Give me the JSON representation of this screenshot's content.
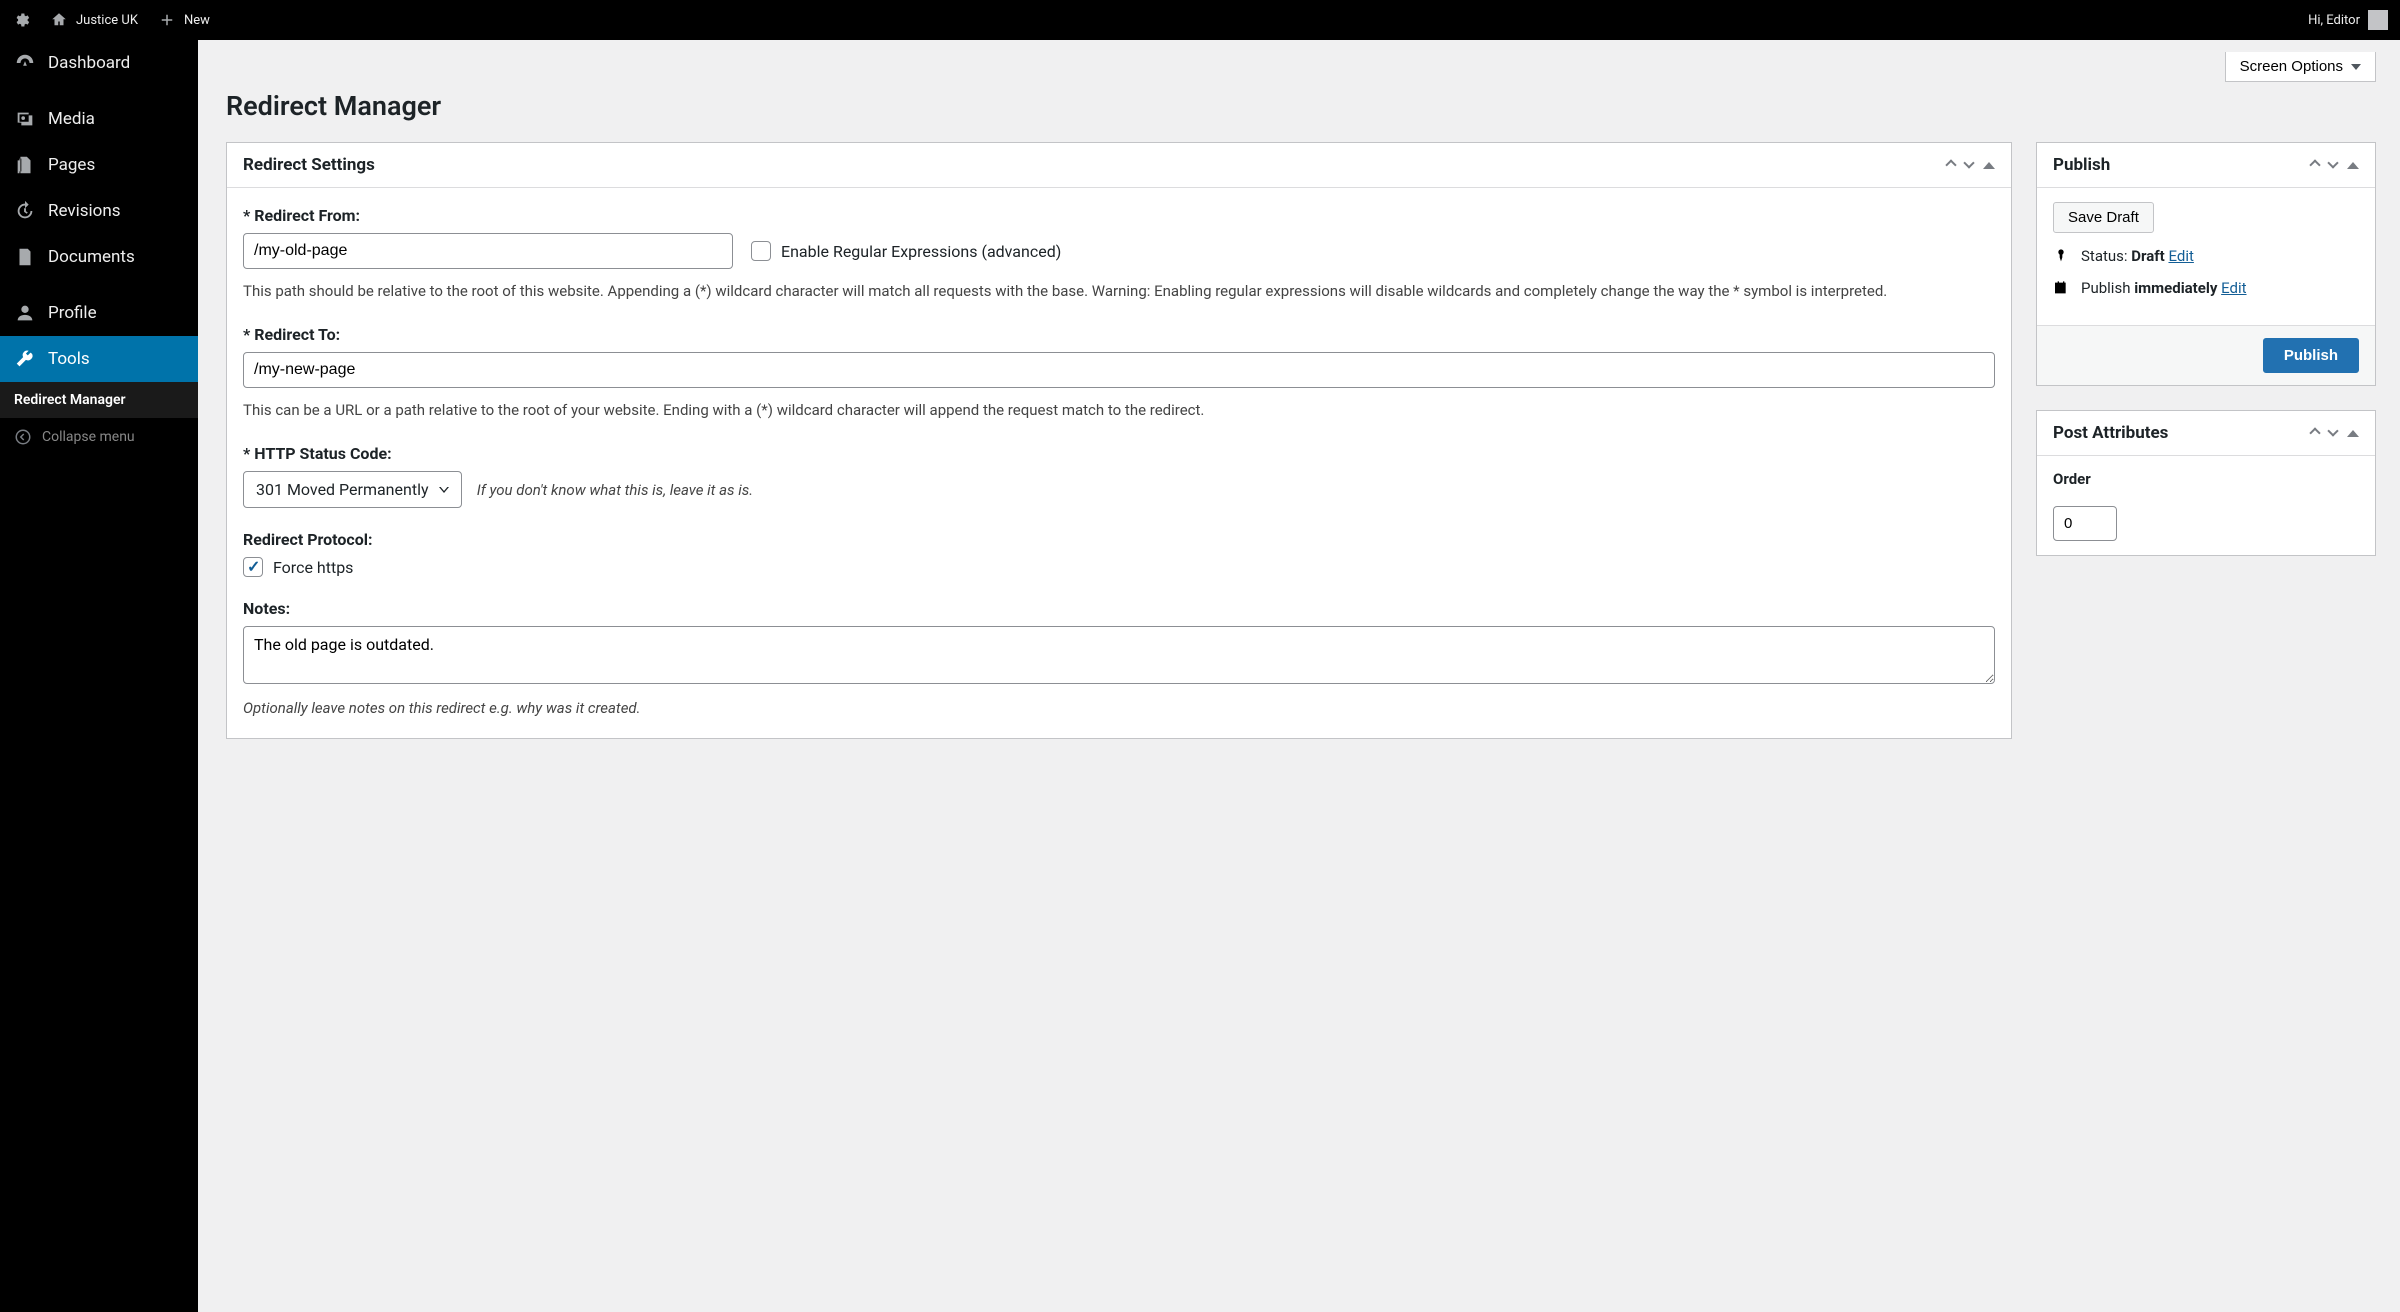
{
  "adminbar": {
    "site_name": "Justice UK",
    "new_label": "New",
    "greeting": "Hi, Editor"
  },
  "sidebar": {
    "items": [
      {
        "label": "Dashboard",
        "icon": "dashboard"
      },
      {
        "label": "Media",
        "icon": "media"
      },
      {
        "label": "Pages",
        "icon": "pages"
      },
      {
        "label": "Revisions",
        "icon": "revisions"
      },
      {
        "label": "Documents",
        "icon": "documents"
      },
      {
        "label": "Profile",
        "icon": "profile"
      },
      {
        "label": "Tools",
        "icon": "tools",
        "active": true
      }
    ],
    "submenu_label": "Redirect Manager",
    "collapse_label": "Collapse menu"
  },
  "screen_options_label": "Screen Options",
  "page_title": "Redirect Manager",
  "metabox": {
    "settings_title": "Redirect Settings",
    "redirect_from": {
      "label": "* Redirect From:",
      "value": "/my-old-page",
      "regex_label": "Enable Regular Expressions (advanced)",
      "regex_checked": false,
      "help": "This path should be relative to the root of this website. Appending a (*) wildcard character will match all requests with the base. Warning: Enabling regular expressions will disable wildcards and completely change the way the * symbol is interpreted."
    },
    "redirect_to": {
      "label": "* Redirect To:",
      "value": "/my-new-page",
      "help": "This can be a URL or a path relative to the root of your website. Ending with a (*) wildcard character will append the request match to the redirect."
    },
    "status_code": {
      "label": "* HTTP Status Code:",
      "selected": "301 Moved Permanently",
      "help": "If you don't know what this is, leave it as is."
    },
    "protocol": {
      "label": "Redirect Protocol:",
      "force_https_label": "Force https",
      "force_https_checked": true
    },
    "notes": {
      "label": "Notes:",
      "value": "The old page is outdated.",
      "help": "Optionally leave notes on this redirect e.g. why was it created."
    }
  },
  "publish": {
    "title": "Publish",
    "save_draft": "Save Draft",
    "status_label": "Status:",
    "status_value": "Draft",
    "edit_label": "Edit",
    "schedule_label": "Publish",
    "schedule_value": "immediately",
    "publish_button": "Publish"
  },
  "attributes": {
    "title": "Post Attributes",
    "order_label": "Order",
    "order_value": "0"
  }
}
